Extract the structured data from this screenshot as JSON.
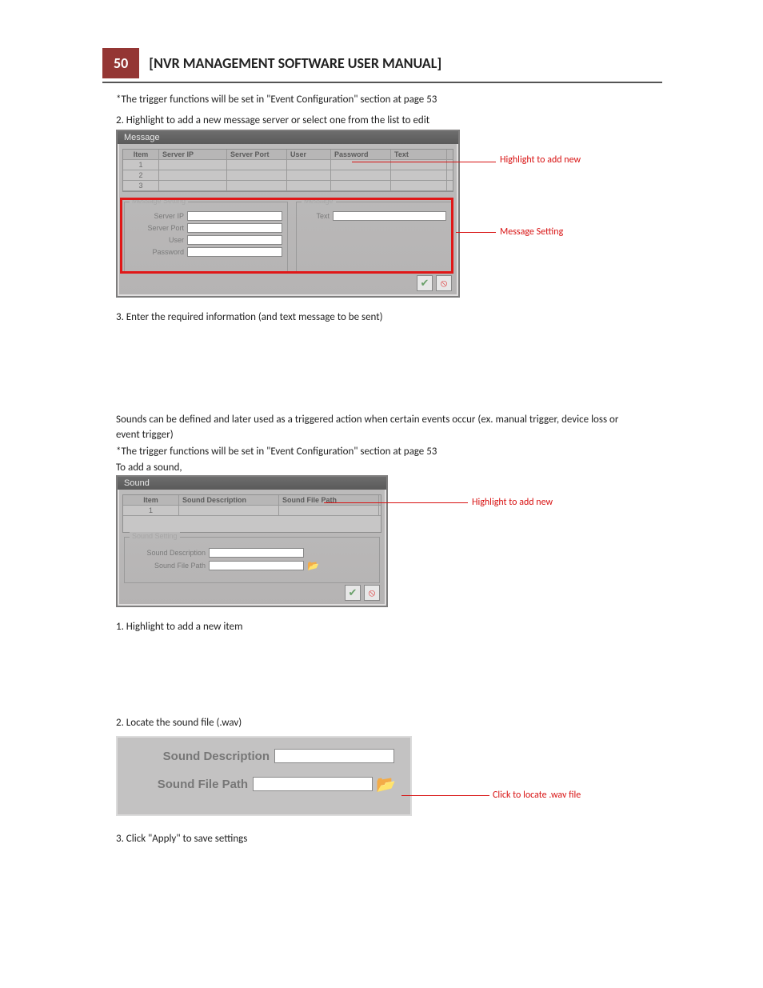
{
  "header": {
    "page_number": "50",
    "title": "[NVR MANAGEMENT SOFTWARE USER MANUAL]"
  },
  "body_text": {
    "msg_trigger": "*The trigger functions will be set in \"Event Configuration\" section at page 53",
    "msg_highlight": "2. Highlight to add a new message server or select one from the list to edit",
    "msg_info": "3. Enter the required information (and text message to be sent)",
    "sound_intro": "Sounds can be defined and later used as a triggered action when certain events occur (ex. manual trigger, device loss or event trigger)",
    "sound_trigger": "*The trigger functions will be set in \"Event Configuration\" section at page 53",
    "sound_add": "To add a sound,",
    "sound_step1": "1. Highlight to add a new item",
    "sound_step2": "2. Locate the sound file (.wav)",
    "sound_step3": "3. Click \"Apply\" to save settings"
  },
  "callouts": {
    "msg_highlight": "Highlight to add new",
    "msg_setting": "Message Setting",
    "sound_highlight": "Highlight to add new",
    "zoom_locate": "Click to locate .wav file"
  },
  "message_dialog": {
    "title": "Message",
    "columns": {
      "item": "Item",
      "server_ip": "Server IP",
      "server_port": "Server Port",
      "user": "User",
      "password": "Password",
      "text": "Text"
    },
    "rows": [
      "1",
      "2",
      "3"
    ],
    "group_setting_title": "Message Setting",
    "group_message_title": "Message",
    "fields": {
      "server_ip": "Server IP",
      "server_port": "Server Port",
      "user": "User",
      "password": "Password",
      "text": "Text"
    }
  },
  "sound_dialog": {
    "title": "Sound",
    "columns": {
      "item": "Item",
      "desc": "Sound Description",
      "path": "Sound File Path"
    },
    "rows": [
      "1"
    ],
    "group_title": "Sound Setting",
    "fields": {
      "desc": "Sound Description",
      "path": "Sound File Path"
    }
  },
  "zoom_panel": {
    "desc_label": "Sound Description",
    "path_label": "Sound File Path"
  },
  "icons": {
    "apply": "✔",
    "cancel": "⦸",
    "browse": "📂"
  },
  "colors": {
    "accent_red": "#d81212",
    "header_red": "#943634"
  }
}
